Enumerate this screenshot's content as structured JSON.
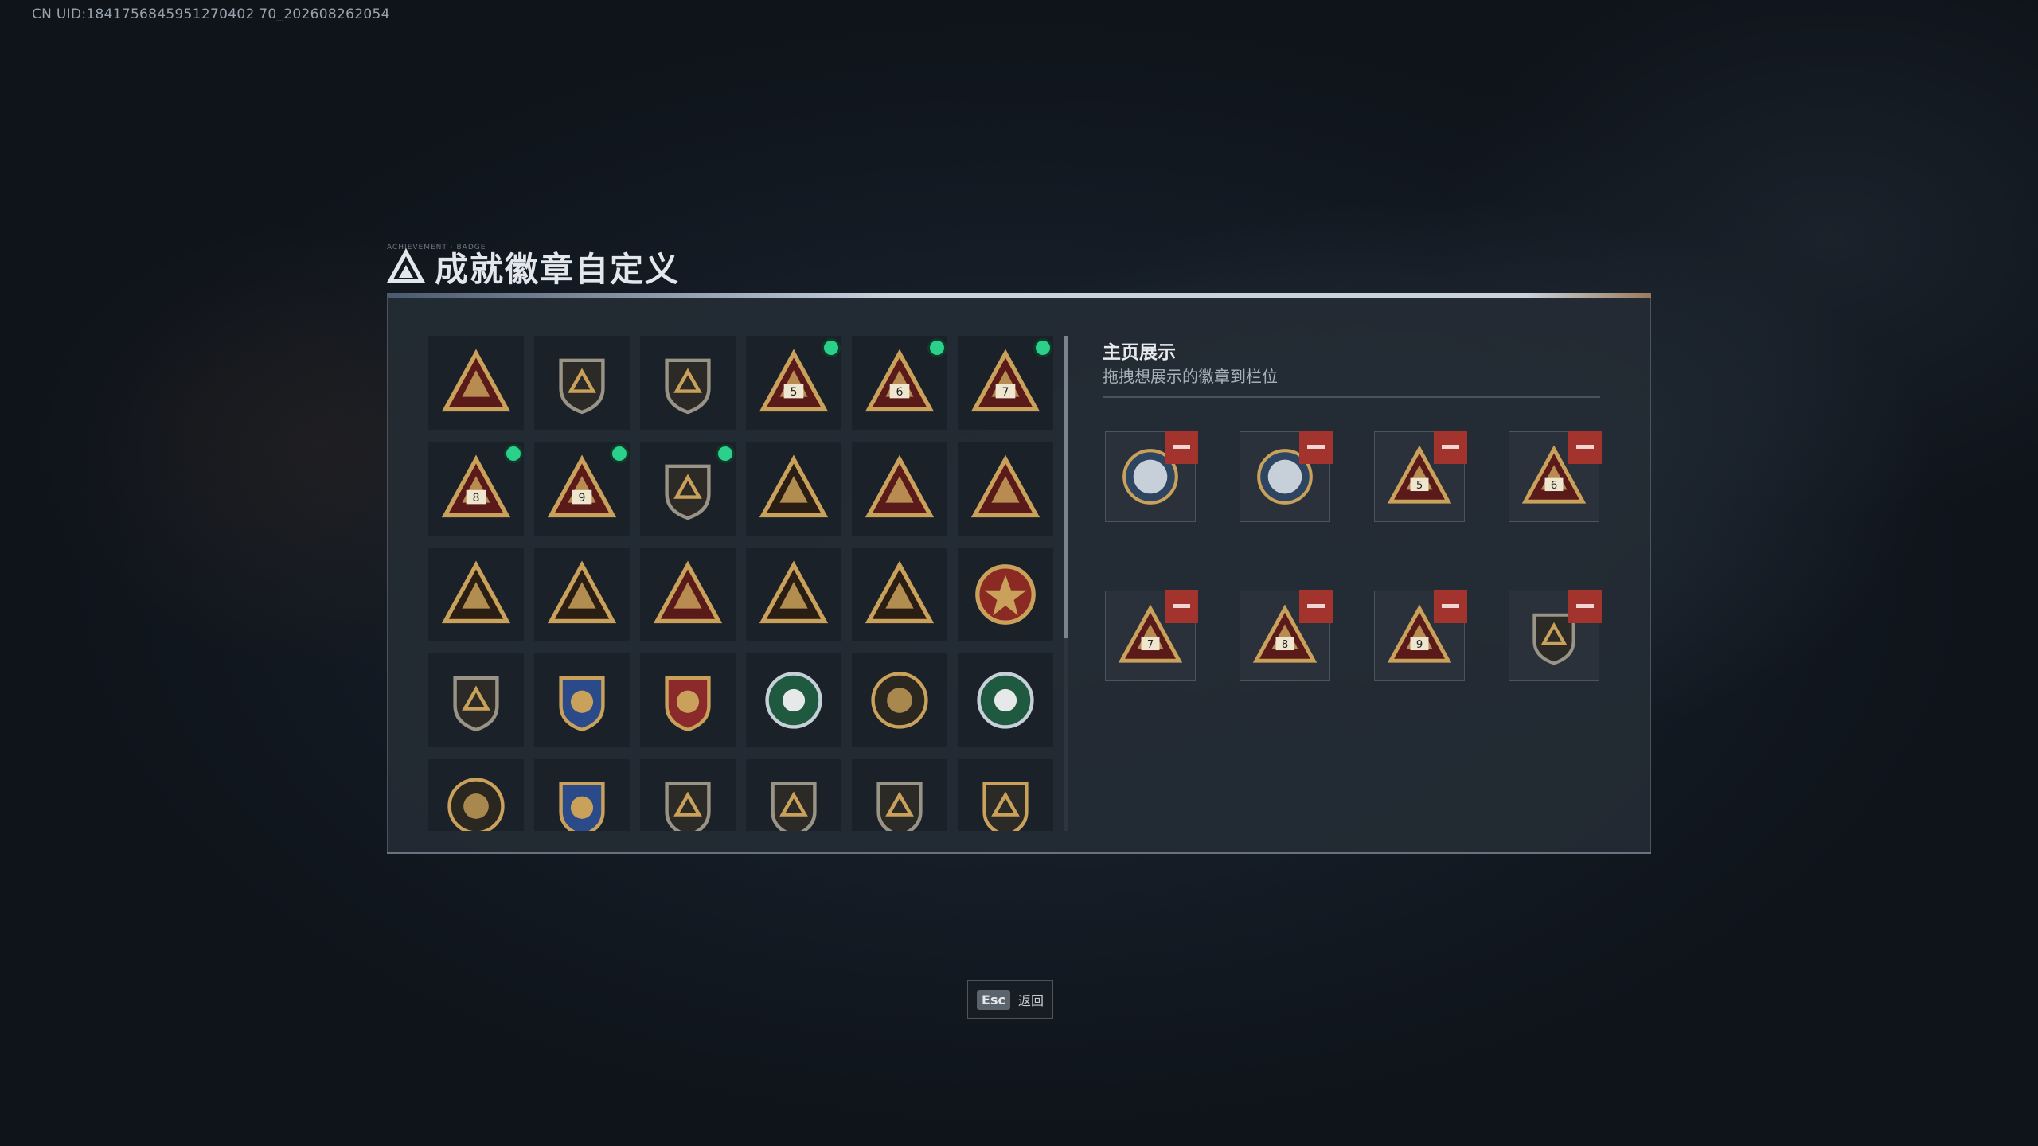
{
  "uid": "CN UID:1841756845951270402 70_202608262054",
  "title": "成就徽章自定义",
  "title_tag": "ACHIEVEMENT · BADGE",
  "side": {
    "title": "主页展示",
    "subtitle": "拖拽想展示的徽章到栏位"
  },
  "esc": {
    "key": "Esc",
    "label": "返回"
  },
  "colors": {
    "gold": "#c9a15a",
    "dark_red": "#5a1a1a",
    "new_dot": "#2bd08a",
    "remove": "#a3332d"
  },
  "grid_badges": [
    {
      "icon": "shield-triangle-badge-icon",
      "new": false
    },
    {
      "icon": "helicopter-shield-badge-icon",
      "new": false
    },
    {
      "icon": "diamond-shield-badge-icon",
      "new": false
    },
    {
      "icon": "s5-triangle-badge-icon",
      "new": true
    },
    {
      "icon": "s6-triangle-badge-icon",
      "new": true
    },
    {
      "icon": "s7-triangle-badge-icon",
      "new": true
    },
    {
      "icon": "s8-triangle-badge-icon",
      "new": true
    },
    {
      "icon": "s9-robot-triangle-badge-icon",
      "new": true
    },
    {
      "icon": "s10-eagle-badge-icon",
      "new": true
    },
    {
      "icon": "hand-triangle-badge-icon",
      "new": false
    },
    {
      "icon": "bird-triangle-badge-icon",
      "new": false
    },
    {
      "icon": "number-one-triangle-badge-icon",
      "new": false
    },
    {
      "icon": "bottle-triangle-badge-icon",
      "new": false
    },
    {
      "icon": "ammo-triangle-badge-icon",
      "new": false
    },
    {
      "icon": "star-triangle-badge-icon",
      "new": false
    },
    {
      "icon": "hand-gold-triangle-badge-icon",
      "new": false
    },
    {
      "icon": "rocket-triangle-badge-icon",
      "new": false
    },
    {
      "icon": "skull-star-medal-icon",
      "new": false
    },
    {
      "icon": "crest-shield-badge-icon",
      "new": false
    },
    {
      "icon": "blue-star-shield-badge-icon",
      "new": false
    },
    {
      "icon": "red-star-shield-badge-icon",
      "new": false
    },
    {
      "icon": "green-globe-badge-icon",
      "new": false
    },
    {
      "icon": "soldier-compass-badge-icon",
      "new": false
    },
    {
      "icon": "green-eye-badge-icon",
      "new": false
    },
    {
      "icon": "bear-round-badge-icon",
      "new": false
    },
    {
      "icon": "rifle-blue-shield-badge-icon",
      "new": false
    },
    {
      "icon": "rifle-shield-badge-icon",
      "new": false
    },
    {
      "icon": "rifle-shield-badge-2-icon",
      "new": false
    },
    {
      "icon": "rifle-shield-badge-3-icon",
      "new": false
    },
    {
      "icon": "rifle-gold-shield-badge-icon",
      "new": false
    }
  ],
  "showcase": [
    {
      "icon": "wolf-medal-icon"
    },
    {
      "icon": "eagle-medal-icon"
    },
    {
      "icon": "s5-triangle-badge-icon"
    },
    {
      "icon": "s6-triangle-badge-icon"
    },
    {
      "icon": "s7-triangle-badge-icon"
    },
    {
      "icon": "s8-triangle-badge-icon"
    },
    {
      "icon": "s9-robot-triangle-badge-icon"
    },
    {
      "icon": "s10-eagle-badge-icon"
    }
  ]
}
